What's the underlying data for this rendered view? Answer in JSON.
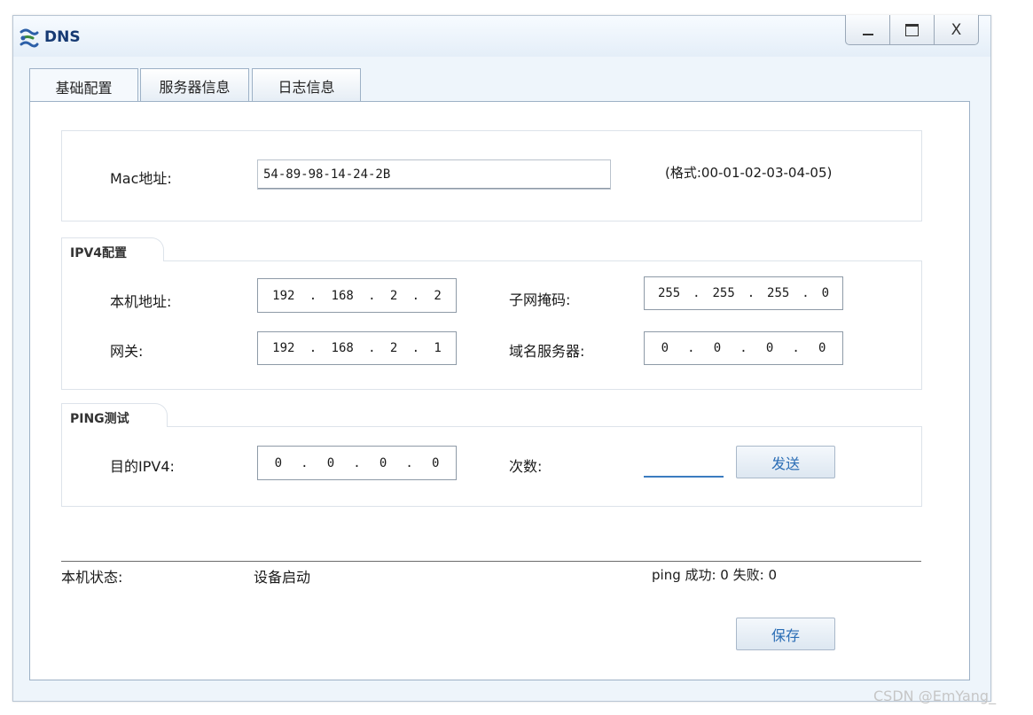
{
  "window": {
    "title": "DNS",
    "controls": {
      "minimize": "_",
      "maximize": "□",
      "close": "X"
    }
  },
  "tabs": [
    {
      "label": "基础配置",
      "active": true
    },
    {
      "label": "服务器信息",
      "active": false
    },
    {
      "label": "日志信息",
      "active": false
    }
  ],
  "mac": {
    "label": "Mac地址:",
    "value": "54-89-98-14-24-2B",
    "hint": "(格式:00-01-02-03-04-05)"
  },
  "ipv4": {
    "legend": "IPV4配置",
    "local_label": "本机地址:",
    "local": [
      "192",
      "168",
      "2",
      "2"
    ],
    "mask_label": "子网掩码:",
    "mask": [
      "255",
      "255",
      "255",
      "0"
    ],
    "gateway_label": "网关:",
    "gateway": [
      "192",
      "168",
      "2",
      "1"
    ],
    "dns_label": "域名服务器:",
    "dns": [
      "0",
      "0",
      "0",
      "0"
    ]
  },
  "ping": {
    "legend": "PING测试",
    "target_label": "目的IPV4:",
    "target": [
      "0",
      "0",
      "0",
      "0"
    ],
    "count_label": "次数:",
    "count_value": "",
    "send_button": "发送"
  },
  "status": {
    "label": "本机状态:",
    "value": "设备启动",
    "ping_result": "ping 成功: 0 失败: 0"
  },
  "save_button": "保存",
  "watermark": "CSDN @EmYang_",
  "colors": {
    "title": "#163a73",
    "button_text": "#2a6db5",
    "accent": "#3b7cc0"
  }
}
